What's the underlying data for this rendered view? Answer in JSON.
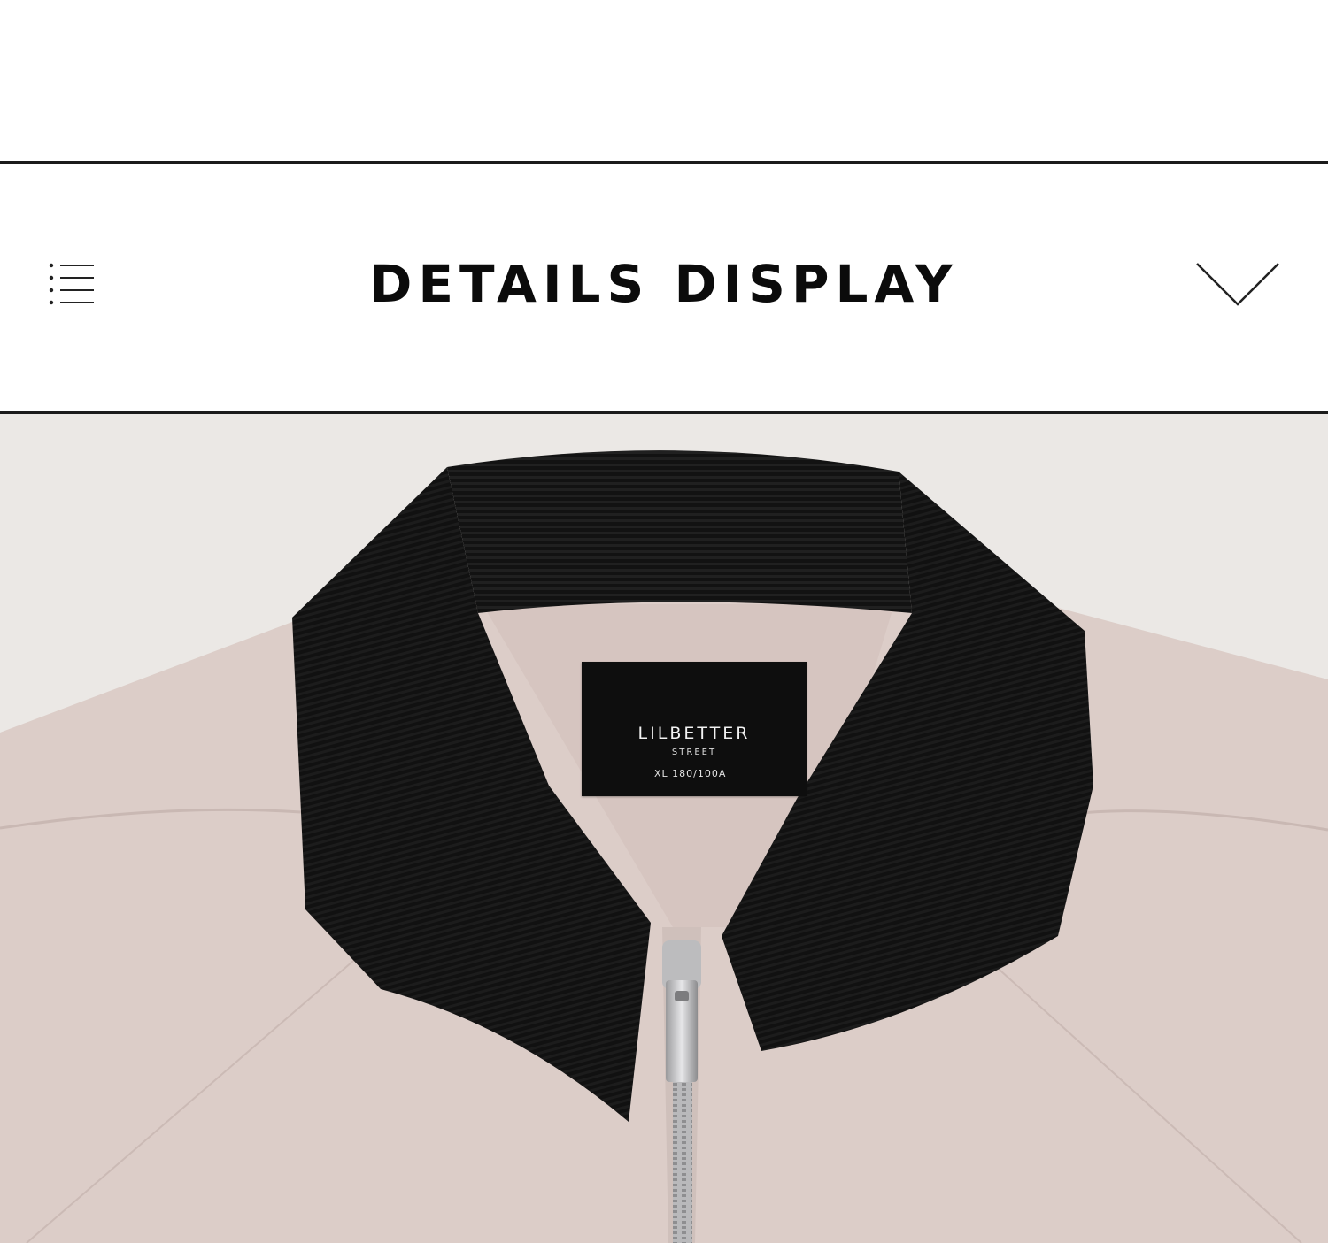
{
  "section": {
    "title": "DETAILS DISPLAY",
    "menu_icon": "list-icon",
    "expand_icon": "chevron-down-icon"
  },
  "product_photo": {
    "label": {
      "brand": "LILBETTER",
      "line": "STREET",
      "size": "XL 180/100A"
    },
    "colors": {
      "background": "#ebe8e5",
      "jacket": "#dccdc8",
      "collar": "#111111",
      "zipper": "#c9c9cb"
    }
  }
}
